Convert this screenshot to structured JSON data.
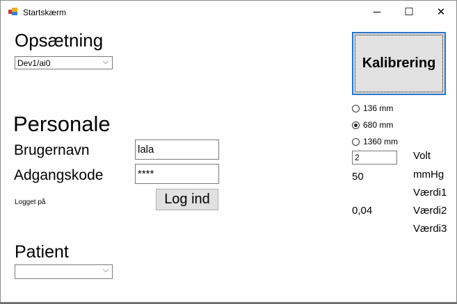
{
  "window": {
    "title": "Startskærm",
    "minimize": "─",
    "maximize": "☐",
    "close": "✕"
  },
  "setup": {
    "heading": "Opsætning",
    "device_value": "Dev1/ai0"
  },
  "staff": {
    "heading": "Personale",
    "username_label": "Brugernavn",
    "username_value": "lala",
    "password_label": "Adgangskode",
    "password_value": "****",
    "login_button": "Log ind",
    "status": "Logget på"
  },
  "patient": {
    "heading": "Patient",
    "patient_value": ""
  },
  "calibration": {
    "button": "Kalibrering",
    "options": [
      "136 mm",
      "680 mm",
      "1360 mm"
    ],
    "selected": "680 mm",
    "volt_value": "2",
    "volt_label": "Volt",
    "mmhg_value": "50",
    "mmhg_label": "mmHg",
    "value1_label": "Værdi1",
    "value2_value": "0,04",
    "value2_label": "Værdi2",
    "value3_label": "Værdi3"
  }
}
